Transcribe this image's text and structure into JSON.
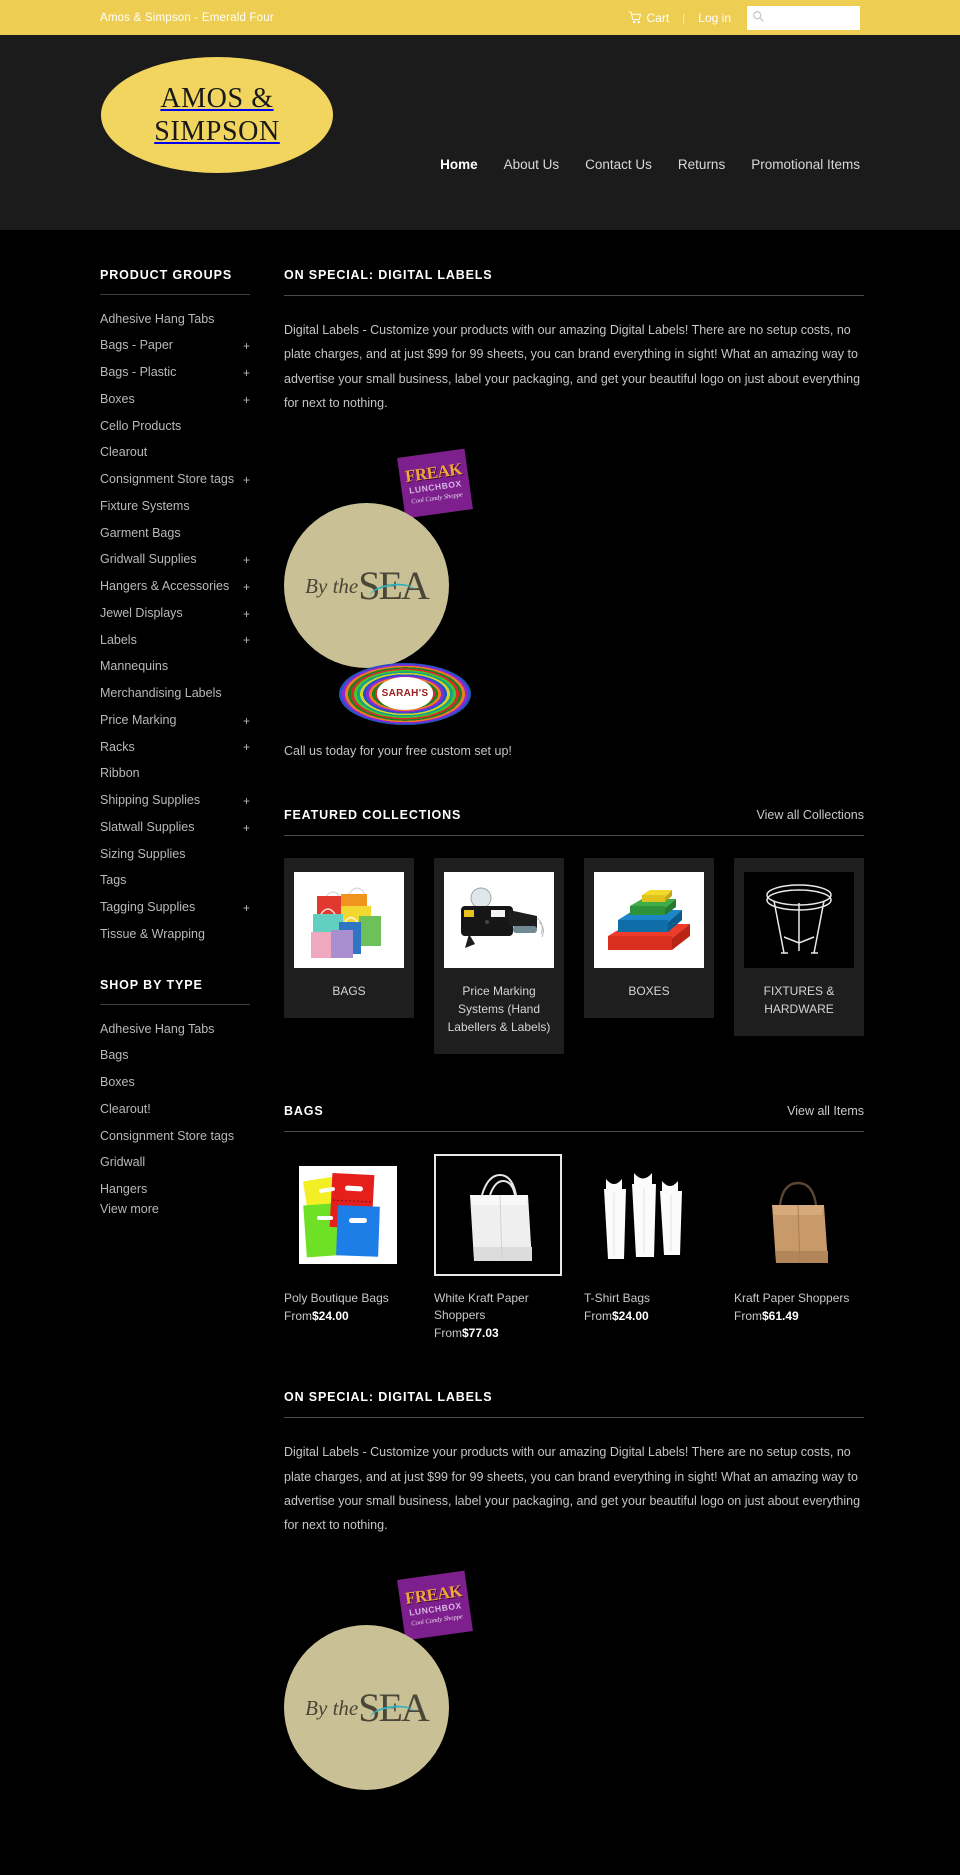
{
  "topbar": {
    "tagline": "Amos & Simpson - Emerald Four",
    "cart_label": "Cart",
    "cart_icon": "shopping-cart-icon",
    "separator": "|",
    "login_label": "Log in",
    "search_icon": "search-icon",
    "search_value": "",
    "search_placeholder": ""
  },
  "header": {
    "logo_line1": "AMOS &",
    "logo_line2": "SIMPSON",
    "nav": [
      {
        "label": "Home",
        "active": true
      },
      {
        "label": "About Us",
        "active": false
      },
      {
        "label": "Contact Us",
        "active": false
      },
      {
        "label": "Returns",
        "active": false
      },
      {
        "label": "Promotional Items",
        "active": false
      }
    ]
  },
  "sidebar": {
    "product_groups_title": "PRODUCT GROUPS",
    "product_groups": [
      {
        "label": "Adhesive Hang Tabs",
        "expander": ""
      },
      {
        "label": "Bags - Paper",
        "expander": "+"
      },
      {
        "label": "Bags - Plastic",
        "expander": "+"
      },
      {
        "label": "Boxes",
        "expander": "+"
      },
      {
        "label": "Cello Products",
        "expander": ""
      },
      {
        "label": "Clearout",
        "expander": ""
      },
      {
        "label": "Consignment Store tags",
        "expander": "+"
      },
      {
        "label": "Fixture Systems",
        "expander": ""
      },
      {
        "label": "Garment Bags",
        "expander": ""
      },
      {
        "label": "Gridwall Supplies",
        "expander": "+"
      },
      {
        "label": "Hangers & Accessories",
        "expander": "+"
      },
      {
        "label": "Jewel Displays",
        "expander": "+"
      },
      {
        "label": "Labels",
        "expander": "+"
      },
      {
        "label": "Mannequins",
        "expander": ""
      },
      {
        "label": "Merchandising Labels",
        "expander": ""
      },
      {
        "label": "Price Marking",
        "expander": "+"
      },
      {
        "label": "Racks",
        "expander": "+"
      },
      {
        "label": "Ribbon",
        "expander": ""
      },
      {
        "label": "Shipping Supplies",
        "expander": "+"
      },
      {
        "label": "Slatwall Supplies",
        "expander": "+"
      },
      {
        "label": "Sizing Supplies",
        "expander": ""
      },
      {
        "label": "Tags",
        "expander": ""
      },
      {
        "label": "Tagging Supplies",
        "expander": "+"
      },
      {
        "label": "Tissue & Wrapping",
        "expander": ""
      }
    ],
    "shop_by_type_title": "SHOP BY TYPE",
    "shop_by_type": [
      {
        "label": "Adhesive Hang Tabs"
      },
      {
        "label": "Bags"
      },
      {
        "label": "Boxes"
      },
      {
        "label": "Clearout!"
      },
      {
        "label": "Consignment Store tags"
      },
      {
        "label": "Gridwall"
      },
      {
        "label": "Hangers"
      },
      {
        "label": "View more"
      }
    ]
  },
  "special": {
    "title": "ON SPECIAL: DIGITAL LABELS",
    "body": "Digital Labels - Customize your products with our amazing Digital Labels! There are no setup costs, no plate charges, and at just $99 for 99 sheets, you can brand everything in sight! What an amazing way to advertise your small business, label your packaging, and get your beautiful logo on just about everything for next to nothing.",
    "callout": "Call us today for your free custom set up!",
    "samples": {
      "freak_line1": "FREAK",
      "freak_line2": "LUNCHBOX",
      "freak_line3": "Cool Candy Shoppe",
      "sea_pre": "By the",
      "sea_big": "SEA",
      "sarah": "SARAH'S"
    }
  },
  "collections": {
    "title": "FEATURED COLLECTIONS",
    "view_all": "View all Collections",
    "items": [
      {
        "name": "BAGS",
        "thumb": "colored-paper-bags-image",
        "thumb_bg": "white"
      },
      {
        "name": "Price Marking Systems (Hand Labellers & Labels)",
        "thumb": "price-gun-labeller-image",
        "thumb_bg": "white"
      },
      {
        "name": "BOXES",
        "thumb": "stacked-colored-boxes-image",
        "thumb_bg": "white"
      },
      {
        "name": "FIXTURES & HARDWARE",
        "thumb": "round-display-table-image",
        "thumb_bg": "black"
      }
    ]
  },
  "bags_section": {
    "title": "BAGS",
    "view_all": "View all Items",
    "products": [
      {
        "name": "Poly Boutique Bags",
        "price_prefix": "From",
        "price": "$24.00",
        "thumb": "poly-boutique-bags-image",
        "framed": false
      },
      {
        "name": "White Kraft Paper Shoppers",
        "price_prefix": "From",
        "price": "$77.03",
        "thumb": "white-kraft-shopper-image",
        "framed": true
      },
      {
        "name": "T-Shirt Bags",
        "price_prefix": "From",
        "price": "$24.00",
        "thumb": "t-shirt-bags-image",
        "framed": false
      },
      {
        "name": "Kraft Paper Shoppers",
        "price_prefix": "From",
        "price": "$61.49",
        "thumb": "kraft-paper-shopper-image",
        "framed": false
      }
    ]
  },
  "special_bottom": {
    "title": "ON SPECIAL: DIGITAL LABELS",
    "body": "Digital Labels - Customize your products with our amazing Digital Labels! There are no setup costs, no plate charges, and at just $99 for 99 sheets, you can brand everything in sight! What an amazing way to advertise your small business, label your packaging, and get your beautiful logo on just about everything for next to nothing."
  },
  "colors": {
    "topbar_yellow": "#edcd52",
    "header_dark": "#1b1b1b",
    "page_black": "#000000",
    "card_gray": "#1e1e1e",
    "text_light": "#c5c5c5"
  }
}
